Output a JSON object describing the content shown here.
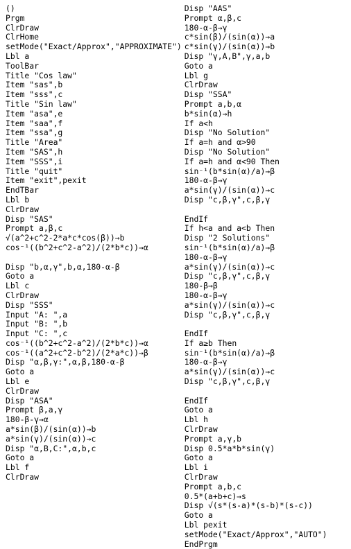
{
  "left": [
    "()",
    "Prgm",
    "ClrDraw",
    "ClrHome",
    "setMode(\"Exact/Approx\",\"APPROXIMATE\")",
    "Lbl a",
    "ToolBar",
    "Title \"Cos law\"",
    "Item \"sas\",b",
    "Item \"sss\",c",
    "Title \"Sin law\"",
    "Item \"asa\",e",
    "Item \"saa\",f",
    "Item \"ssa\",g",
    "Title \"Area\"",
    "Item \"SAS\",h",
    "Item \"SSS\",i",
    "Title \"quit\"",
    "Item \"exit\",pexit",
    "EndTBar",
    "Lbl b",
    "ClrDraw",
    "Disp \"SAS\"",
    "Prompt a,β,c",
    "√(a^2+c^2-2*a*c*cos(β))→b",
    "cos⁻¹((b^2+c^2-a^2)/(2*b*c))→α",
    "",
    "Disp \"b,α,γ\",b,α,180-α-β",
    "Goto a",
    "Lbl c",
    "ClrDraw",
    "Disp \"SSS\"",
    "Input \"A: \",a",
    "Input \"B: \",b",
    "Input \"C: \",c",
    "cos⁻¹((b^2+c^2-a^2)/(2*b*c))→α",
    "cos⁻¹((a^2+c^2-b^2)/(2*a*c))→β",
    "Disp \"α,β,γ:\",α,β,180-α-β",
    "Goto a",
    "Lbl e",
    "ClrDraw",
    "Disp \"ASA\"",
    "Prompt β,a,γ",
    "180-β-γ→α",
    "a*sin(β)/(sin(α))→b",
    "a*sin(γ)/(sin(α))→c",
    "Disp \"α,B,C:\",α,b,c",
    "Goto a",
    "Lbl f",
    "ClrDraw"
  ],
  "right": [
    "Disp \"AAS\"",
    "Prompt α,β,c",
    "180-α-β→γ",
    "c*sin(β)/(sin(α))→a",
    "c*sin(γ)/(sin(α))→b",
    "Disp \"γ,A,B\",γ,a,b",
    "Goto a",
    "Lbl g",
    "ClrDraw",
    "Disp \"SSA\"",
    "Prompt a,b,α",
    "b*sin(α)→h",
    "If a<h",
    "Disp \"No Solution\"",
    "If a=h and α>90",
    "Disp \"No Solution\"",
    "If a=h and α<90 Then",
    "sin⁻¹(b*sin(α)/a)→β",
    "180-α-β→γ",
    "a*sin(γ)/(sin(α))→c",
    "Disp \"c,β,γ\",c,β,γ",
    "",
    "EndIf",
    "If h<a and a<b Then",
    "Disp \"2 Solutions\"",
    "sin⁻¹(b*sin(α)/a)→β",
    "180-α-β→γ",
    "a*sin(γ)/(sin(α))→c",
    "Disp \"c,β,γ\",c,β,γ",
    "180-β→β",
    "180-α-β→γ",
    "a*sin(γ)/(sin(α))→c",
    "Disp \"c,β,γ\",c,β,γ",
    "",
    "EndIf",
    "If a≥b Then",
    "sin⁻¹(b*sin(α)/a)→β",
    "180-α-β→γ",
    "a*sin(γ)/(sin(α))→c",
    "Disp \"c,β,γ\",c,β,γ",
    "",
    "EndIf",
    "Goto a",
    "Lbl h",
    "ClrDraw",
    "Prompt a,γ,b",
    "Disp 0.5*a*b*sin(γ)",
    "Goto a",
    "Lbl i",
    "ClrDraw",
    "Prompt a,b,c",
    "0.5*(a+b+c)→s",
    "Disp √(s*(s-a)*(s-b)*(s-c))",
    "Goto a",
    "Lbl pexit",
    "setMode(\"Exact/Approx\",\"AUTO\")",
    "EndPrgm"
  ]
}
